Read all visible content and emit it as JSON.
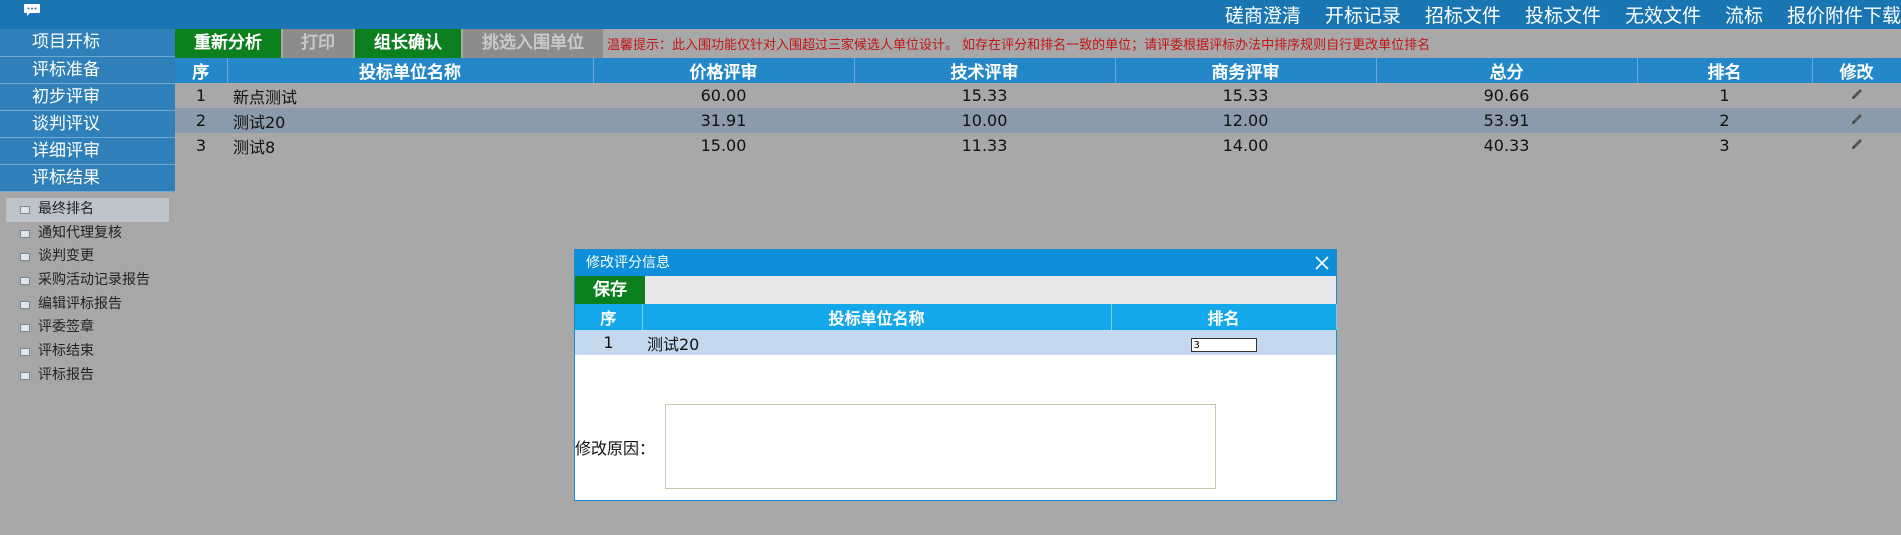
{
  "topbar": {
    "nav": [
      "磋商澄清",
      "开标记录",
      "招标文件",
      "投标文件",
      "无效文件",
      "流标",
      "报价附件下载"
    ]
  },
  "sidebar": {
    "menu": [
      "项目开标",
      "评标准备",
      "初步评审",
      "谈判评议",
      "详细评审",
      "评标结果"
    ],
    "submenu": [
      "最终排名",
      "通知代理复核",
      "谈判变更",
      "采购活动记录报告",
      "编辑评标报告",
      "评委签章",
      "评标结束",
      "评标报告"
    ]
  },
  "toolbar": {
    "reanalyze": "重新分析",
    "print": "打印",
    "leader_confirm": "组长确认",
    "select_shortlist": "挑选入围单位",
    "notice": "温馨提示：此入围功能仅针对入围超过三家候选人单位设计。 如存在评分和排名一致的单位；请评委根据评标办法中排序规则自行更改单位排名"
  },
  "table": {
    "headers": [
      "序",
      "投标单位名称",
      "价格评审",
      "技术评审",
      "商务评审",
      "总分",
      "排名",
      "修改"
    ],
    "rows": [
      {
        "no": "1",
        "name": "新点测试",
        "price": "60.00",
        "tech": "15.33",
        "biz": "15.33",
        "total": "90.66",
        "rank": "1"
      },
      {
        "no": "2",
        "name": "测试20",
        "price": "31.91",
        "tech": "10.00",
        "biz": "12.00",
        "total": "53.91",
        "rank": "2"
      },
      {
        "no": "3",
        "name": "测试8",
        "price": "15.00",
        "tech": "11.33",
        "biz": "14.00",
        "total": "40.33",
        "rank": "3"
      }
    ]
  },
  "modal": {
    "title": "修改评分信息",
    "save": "保存",
    "headers": [
      "序",
      "投标单位名称",
      "排名"
    ],
    "row": {
      "no": "1",
      "name": "测试20",
      "rank_value": "3"
    },
    "reason_label": "修改原因："
  }
}
